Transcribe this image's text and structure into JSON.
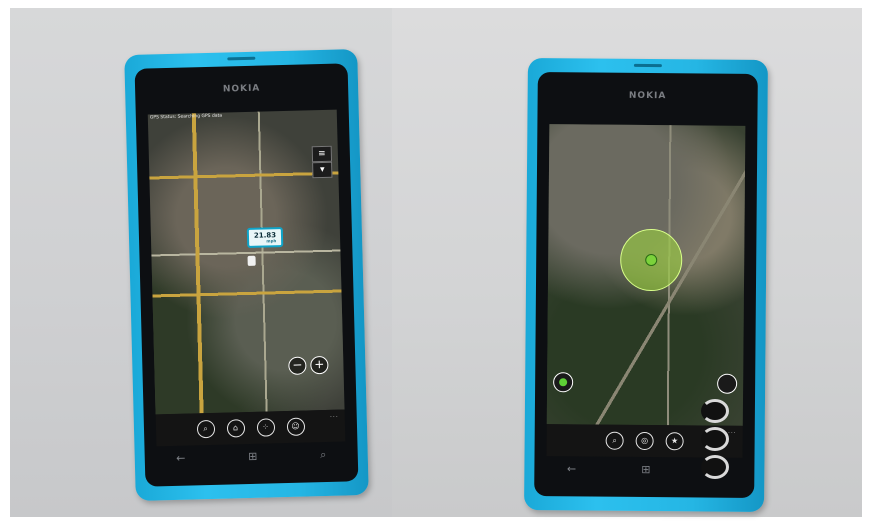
{
  "photo_left": {
    "brand": "NOKIA",
    "status_text": "GPS Status: Searching GPS data",
    "speed_value": "21.83",
    "speed_unit": "mph",
    "zoom_out_glyph": "−",
    "zoom_in_glyph": "+",
    "appbar_icons": [
      "search-icon",
      "home-icon",
      "share-icon",
      "people-icon"
    ],
    "appbar_more": "...",
    "hw_keys": [
      "back-icon",
      "windows-icon",
      "search-icon"
    ]
  },
  "photo_right": {
    "brand": "NOKIA",
    "appbar_icons": [
      "search-icon",
      "locate-icon",
      "star-icon"
    ],
    "appbar_more": "...",
    "hw_keys": [
      "back-icon",
      "windows-icon",
      "search-icon"
    ],
    "spinner_more": "..."
  },
  "colors": {
    "phone_body": "#25b6e4",
    "accent_badge": "#0fa4c9",
    "locate_fill": "#a0dc3c"
  }
}
